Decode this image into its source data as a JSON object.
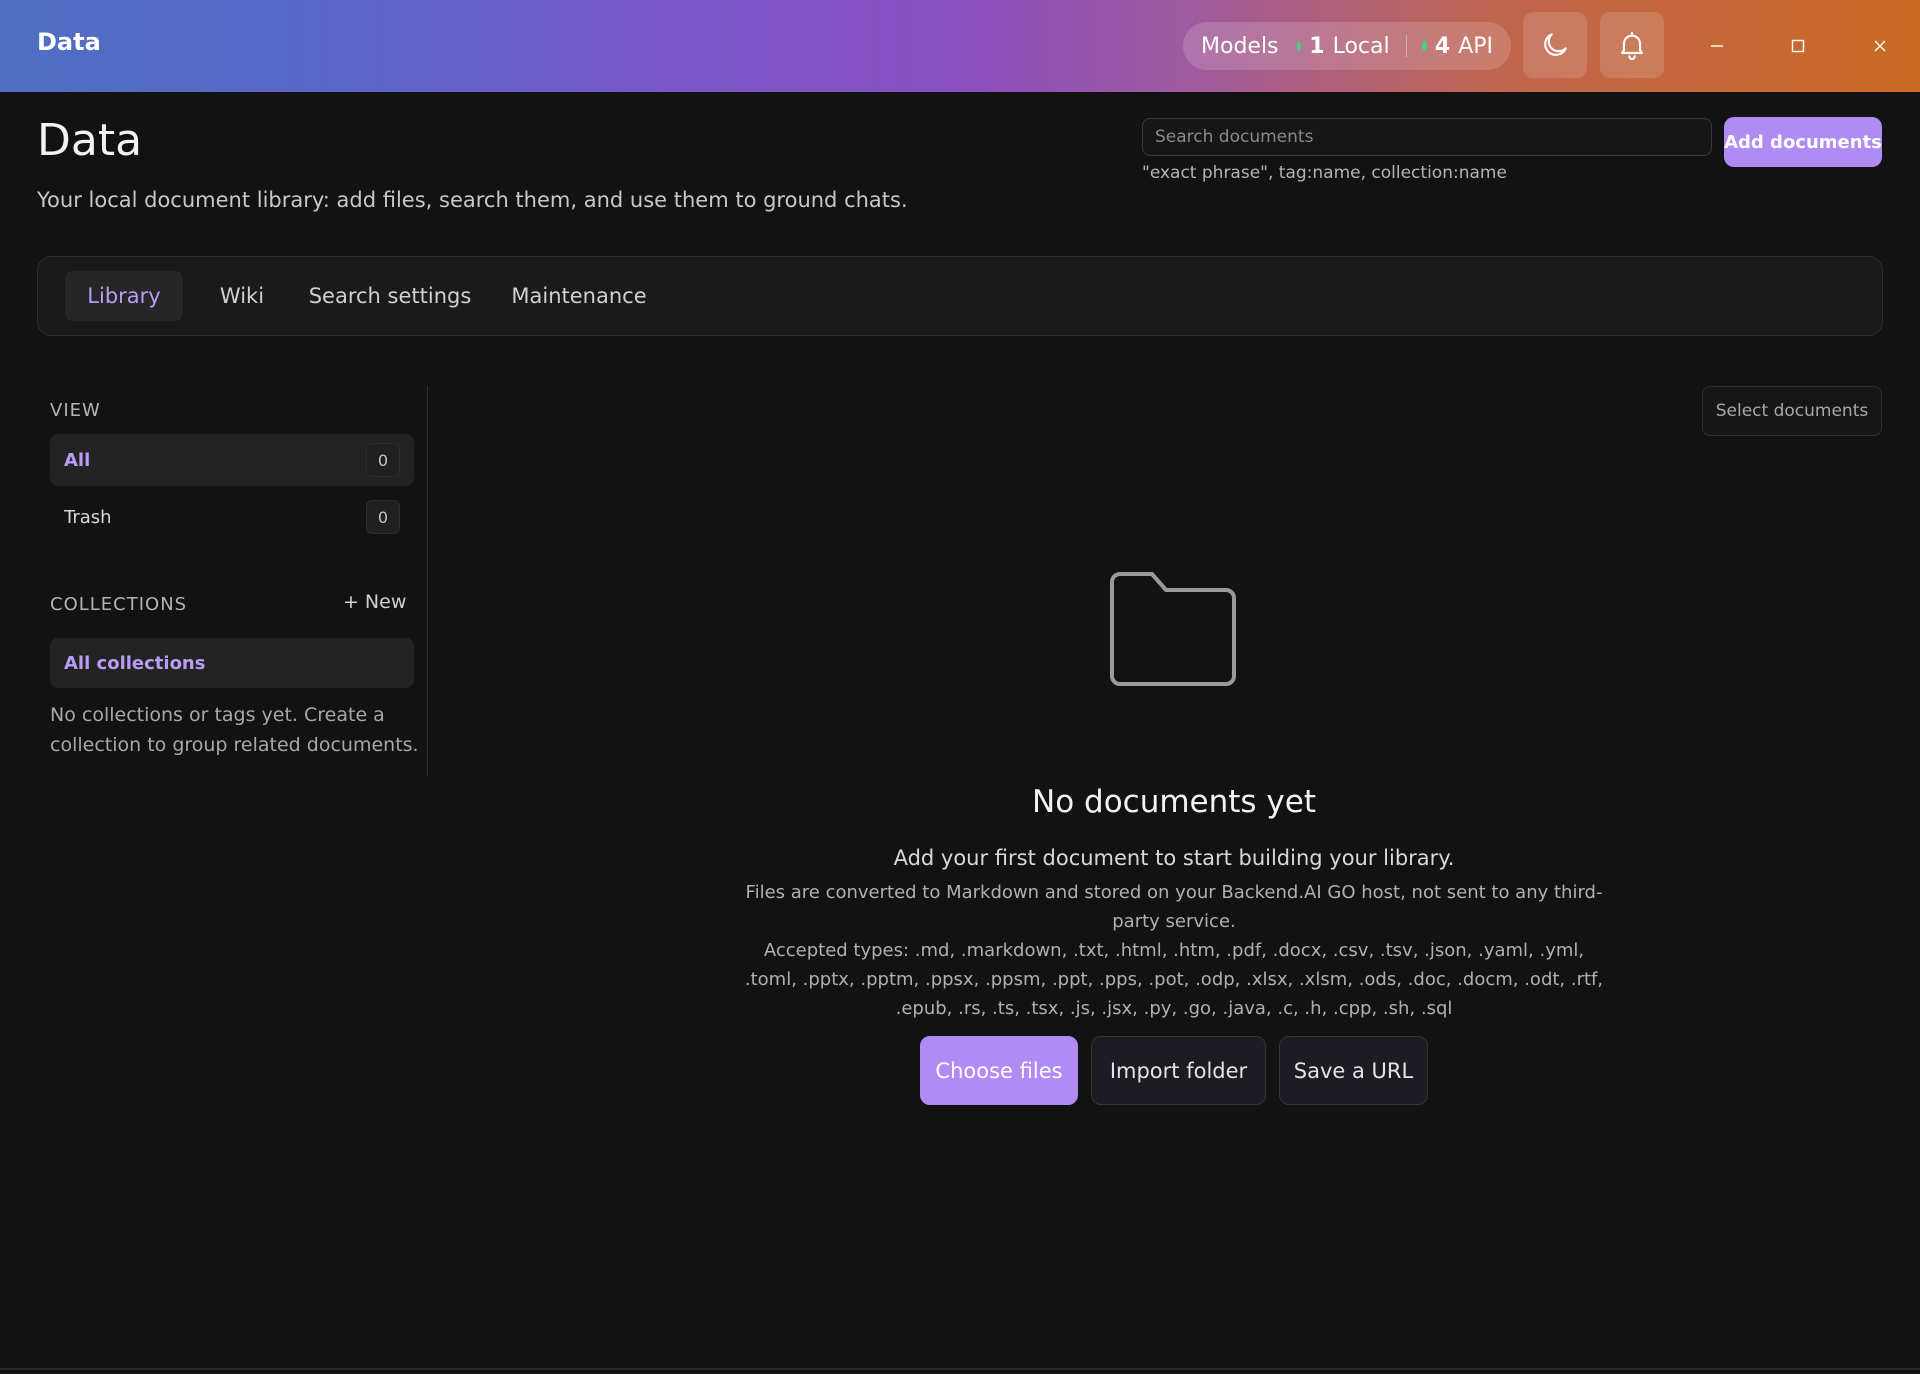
{
  "window": {
    "app_title": "Data",
    "models_label": "Models",
    "local_count": "1",
    "local_label": "Local",
    "api_count": "4",
    "api_label": "API",
    "status_color": "#3fd18a"
  },
  "header": {
    "title": "Data",
    "subtitle": "Your local document library: add files, search them, and use them to ground chats.",
    "search_placeholder": "Search documents",
    "search_hint": "\"exact phrase\", tag:name, collection:name",
    "add_button": "Add documents"
  },
  "tabs": [
    {
      "label": "Library",
      "active": true
    },
    {
      "label": "Wiki"
    },
    {
      "label": "Search settings"
    },
    {
      "label": "Maintenance"
    }
  ],
  "sidebar": {
    "view_heading": "VIEW",
    "view_items": [
      {
        "label": "All",
        "count": "0"
      },
      {
        "label": "Trash",
        "count": "0"
      }
    ],
    "collections_heading": "COLLECTIONS",
    "new_label": "New",
    "all_collections": "All collections",
    "empty_note": "No collections or tags yet. Create a collection to group related documents."
  },
  "main": {
    "select_button": "Select documents",
    "empty_title": "No documents yet",
    "empty_lead": "Add your first document to start building your library.",
    "empty_note": "Files are converted to Markdown and stored on your Backend.AI GO host, not sent to any third-party service.",
    "accepted_types": "Accepted types: .md, .markdown, .txt, .html, .htm, .pdf, .docx, .csv, .tsv, .json, .yaml, .yml, .toml, .pptx, .pptm, .ppsx, .ppsm, .ppt, .pps, .pot, .odp, .xlsx, .xlsm, .ods, .doc, .docm, .odt, .rtf, .epub, .rs, .ts, .tsx, .js, .jsx, .py, .go, .java, .c, .h, .cpp, .sh, .sql",
    "choose_files": "Choose files",
    "import_folder": "Import folder",
    "save_url": "Save a URL"
  },
  "colors": {
    "accent": "#b08bf3",
    "background": "#121212"
  }
}
